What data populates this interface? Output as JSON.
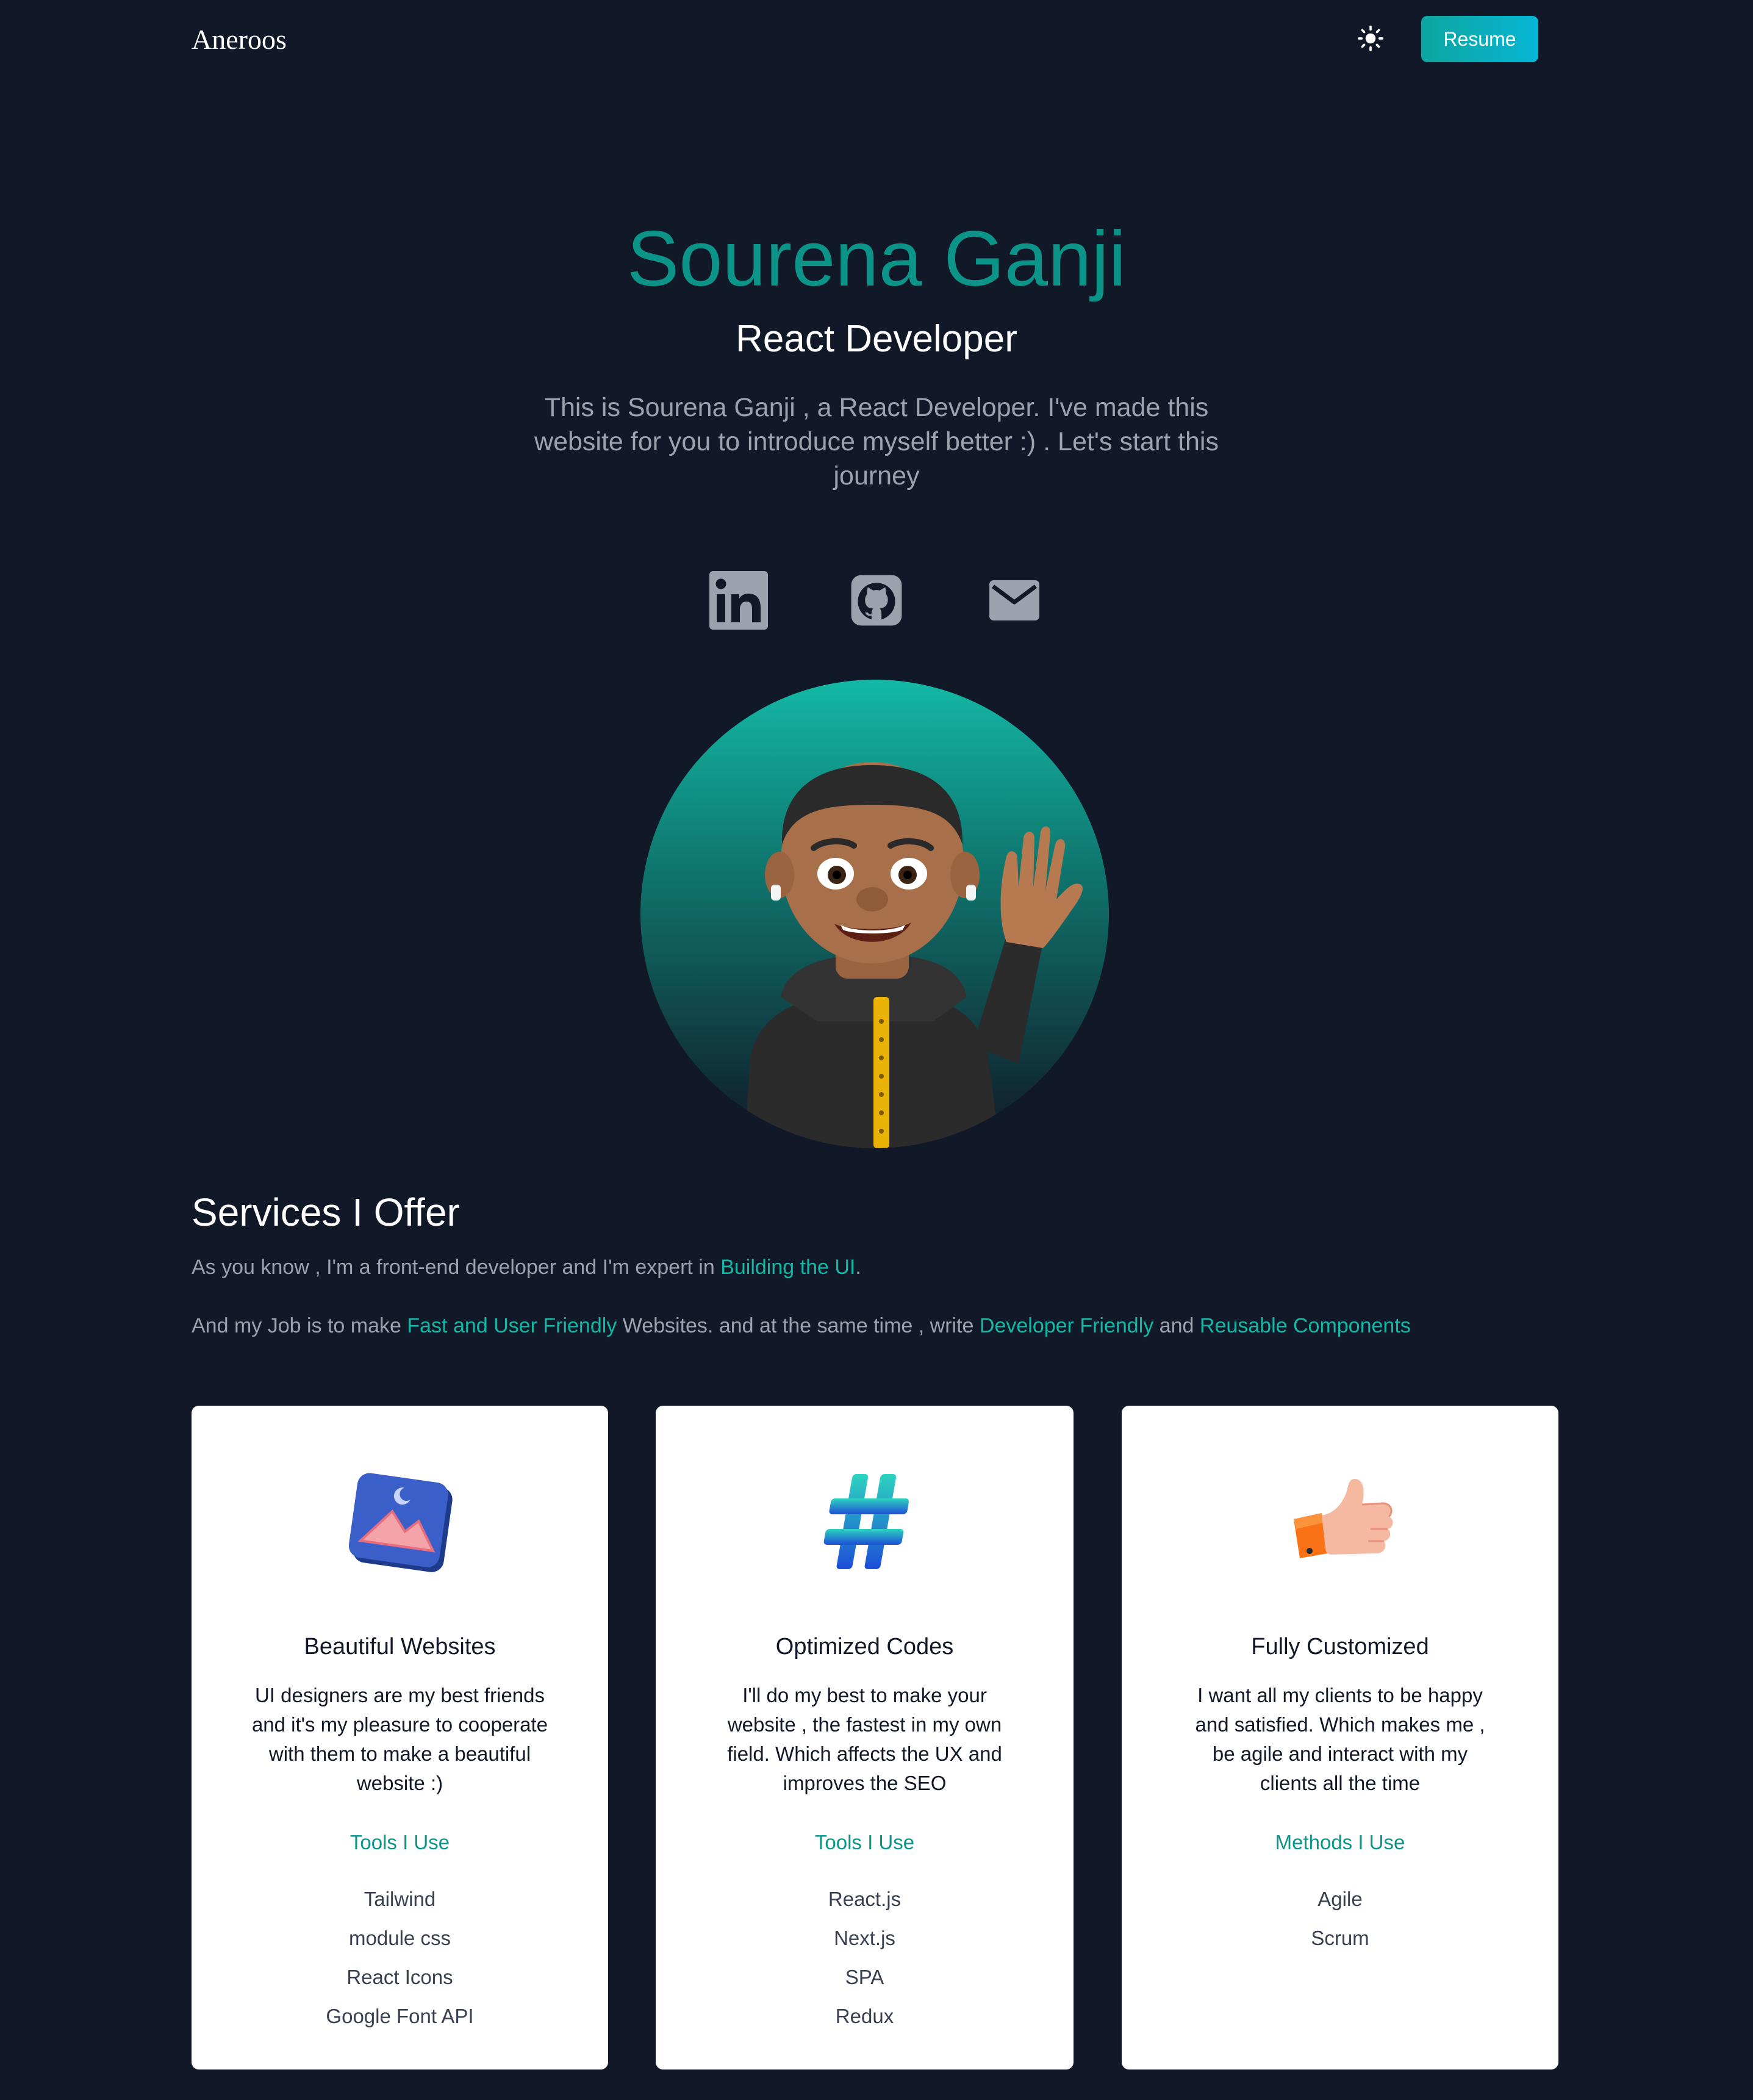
{
  "nav": {
    "logo": "Aneroos",
    "resume_label": "Resume"
  },
  "hero": {
    "name": "Sourena Ganji",
    "role": "React Developer",
    "description": "This is Sourena Ganji , a React Developer. I've made this website for you to introduce myself better :) . Let's start this journey"
  },
  "socials": [
    {
      "icon": "linkedin-icon"
    },
    {
      "icon": "github-icon"
    },
    {
      "icon": "mail-icon"
    }
  ],
  "services": {
    "title": "Services I Offer",
    "line1_a": "As you know , I'm a front-end developer and I'm expert in ",
    "line1_hl": "Building the UI",
    "line1_b": ".",
    "line2_a": "And my Job is to make ",
    "line2_hl1": "Fast and User Friendly",
    "line2_b": " Websites. and at the same time , write ",
    "line2_hl2": "Developer Friendly",
    "line2_c": " and ",
    "line2_hl3": "Reusable Components"
  },
  "cards": [
    {
      "title": "Beautiful Websites",
      "description": "UI designers are my best friends and it's my pleasure to cooperate with them to make a beautiful website :)",
      "list_title": "Tools I Use",
      "items": [
        "Tailwind",
        "module css",
        "React Icons",
        "Google Font API"
      ]
    },
    {
      "title": "Optimized Codes",
      "description": "I'll do my best to make your website , the fastest in my own field. Which affects the UX and improves the SEO",
      "list_title": "Tools I Use",
      "items": [
        "React.js",
        "Next.js",
        "SPA",
        "Redux"
      ]
    },
    {
      "title": "Fully Customized",
      "description": "I want all my clients to be happy and satisfied. Which makes me , be agile and interact with my clients all the time",
      "list_title": "Methods I Use",
      "items": [
        "Agile",
        "Scrum"
      ]
    }
  ],
  "colors": {
    "background": "#111827",
    "accent": "#0d9488",
    "button": "#06b6d4"
  }
}
